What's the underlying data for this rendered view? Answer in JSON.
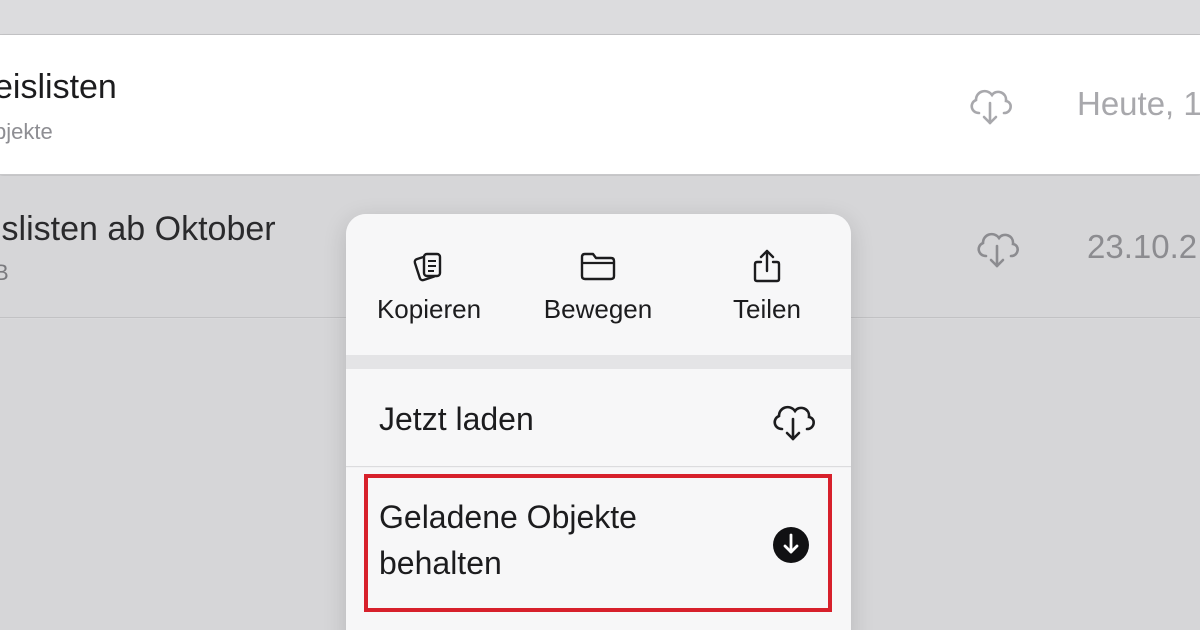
{
  "rows": [
    {
      "name": "eislisten",
      "sub": "bjekte",
      "date": "Heute, 1",
      "cloud_icon": "cloud-download-icon"
    },
    {
      "name": "islisten ab Oktober",
      "sub": "B",
      "date": "23.10.2",
      "cloud_icon": "cloud-download-icon"
    }
  ],
  "menu": {
    "quick_actions": [
      {
        "label": "Kopieren",
        "icon": "copy-icon"
      },
      {
        "label": "Bewegen",
        "icon": "folder-icon"
      },
      {
        "label": "Teilen",
        "icon": "share-icon"
      }
    ],
    "items": [
      {
        "label": "Jetzt laden",
        "icon": "cloud-download-icon"
      },
      {
        "label_line1": "Geladene Objekte",
        "label_line2": "behalten",
        "icon": "download-circle-icon"
      }
    ]
  },
  "colors": {
    "highlight": "#d7202b",
    "text": "#1c1c1e",
    "secondary_text": "#8e8e93"
  }
}
